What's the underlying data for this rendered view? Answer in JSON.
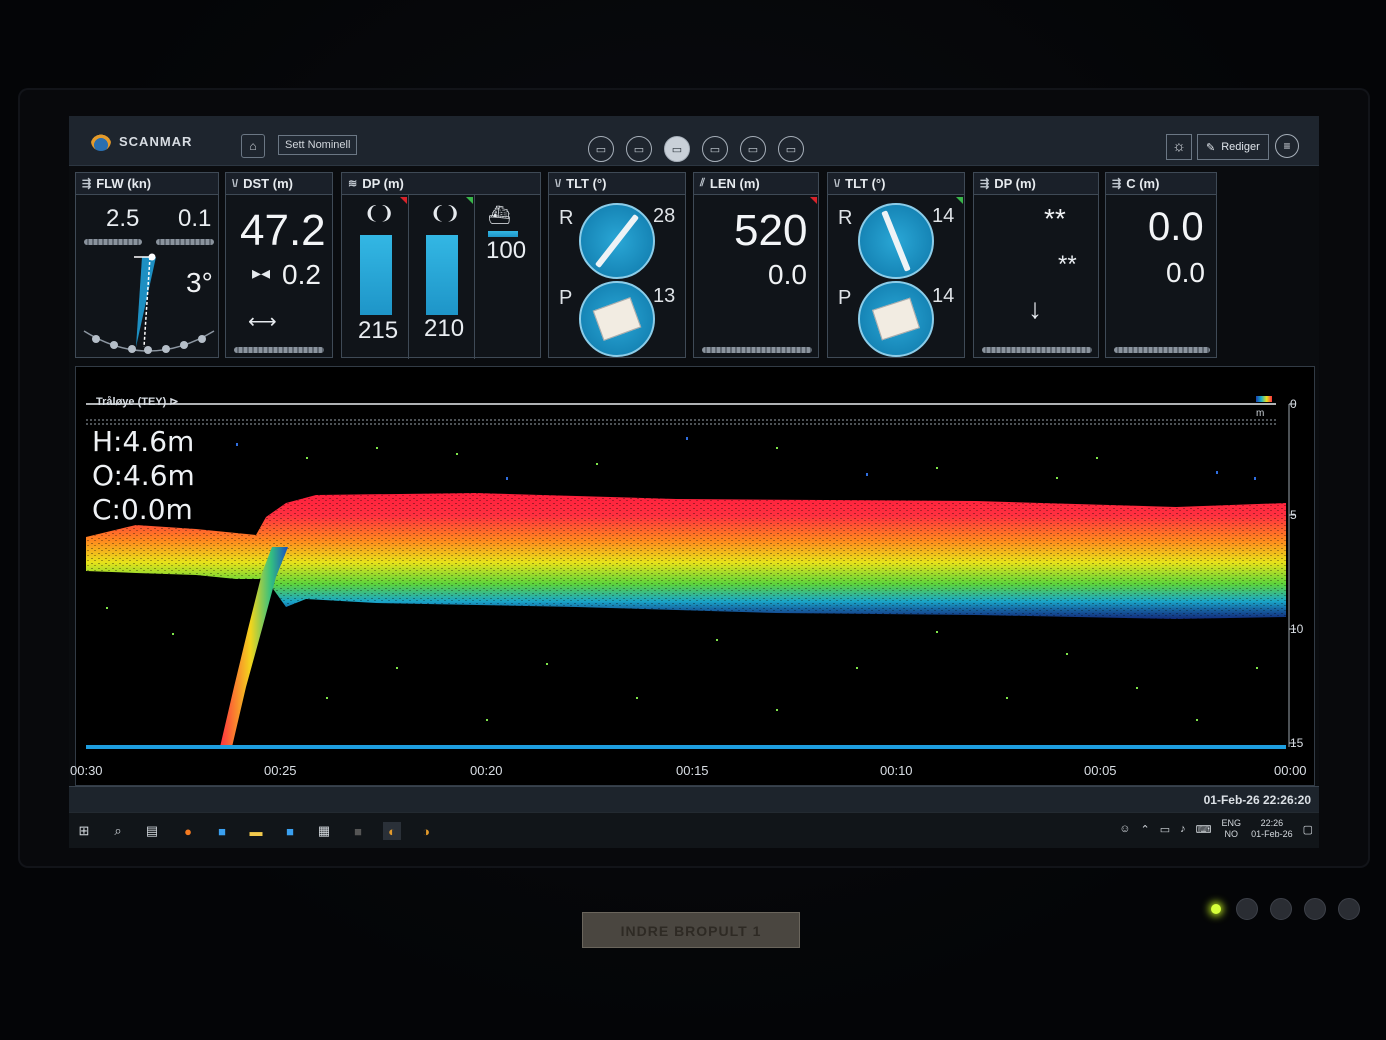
{
  "titlebar": {
    "brand": "SCANMAR",
    "nominal_button": "Sett Nominell",
    "edit_button": "Rediger",
    "views": [
      "1",
      "2",
      "3",
      "4",
      "5",
      "6"
    ],
    "active_view": 3
  },
  "panels": {
    "flw": {
      "title": "FLW (kn)",
      "left_value": "2.5",
      "right_value": "0.1",
      "angle": "3°"
    },
    "dst": {
      "title": "DST (m)",
      "value": "47.2",
      "sub_value": "0.2"
    },
    "dp_pair": {
      "title": "DP (m)",
      "left_value": "215",
      "right_value": "210",
      "ship_value": "100"
    },
    "tlt1": {
      "title": "TLT (°)",
      "roll_label": "R",
      "roll_value": "28",
      "pitch_label": "P",
      "pitch_value": "13"
    },
    "len": {
      "title": "LEN (m)",
      "value": "520",
      "sub_value": "0.0"
    },
    "tlt2": {
      "title": "TLT (°)",
      "roll_label": "R",
      "roll_value": "14",
      "pitch_label": "P",
      "pitch_value": "14"
    },
    "dp_single": {
      "title": "DP (m)",
      "value": "**",
      "sub_value": "**"
    },
    "c": {
      "title": "C (m)",
      "value": "0.0",
      "sub_value": "0.0"
    }
  },
  "echogram": {
    "sensor_label": "Tråløye (TEY)",
    "readouts": {
      "h": "H:4.6m",
      "o": "O:4.6m",
      "c": "C:0.0m"
    },
    "x_ticks": [
      "00:30",
      "00:25",
      "00:20",
      "00:15",
      "00:10",
      "00:05",
      "00:00"
    ],
    "y_ticks": [
      "0",
      "5",
      "10",
      "15"
    ],
    "y_unit": "m"
  },
  "status": {
    "datetime": "01-Feb-26 22:26:20"
  },
  "taskbar": {
    "lang_top": "ENG",
    "lang_bottom": "NO",
    "time": "22:26",
    "date": "01-Feb-26"
  },
  "console": {
    "plate": "INDRE BROPULT 1"
  }
}
